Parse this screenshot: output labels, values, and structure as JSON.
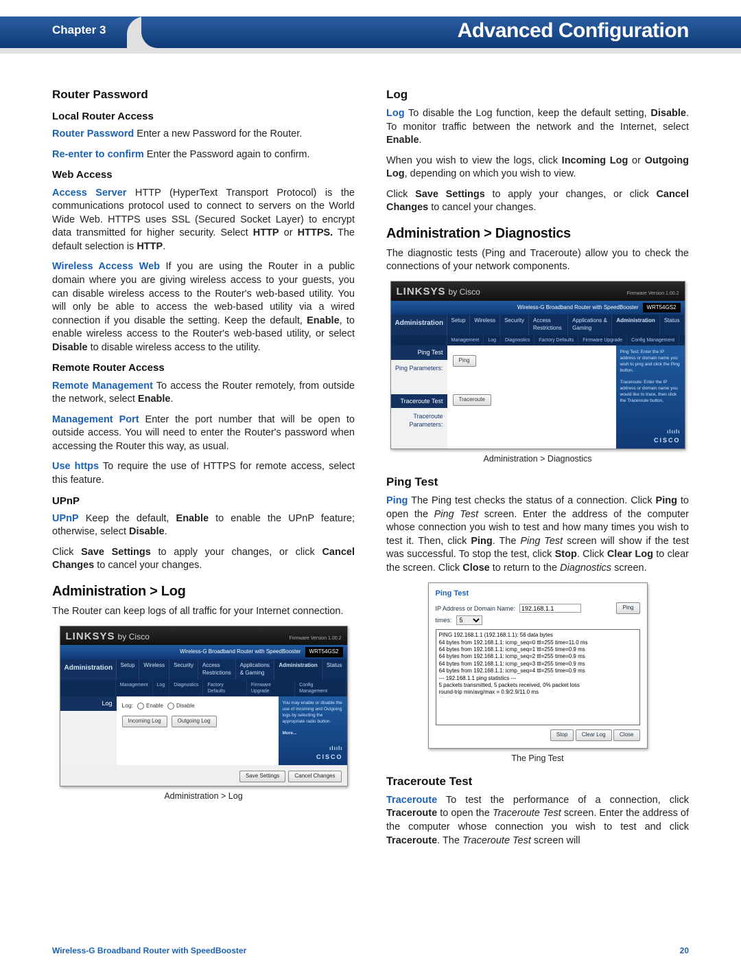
{
  "header": {
    "chapter": "Chapter 3",
    "title": "Advanced Configuration"
  },
  "left": {
    "h_router_password": "Router Password",
    "h_local": "Local Router Access",
    "p_rp": {
      "kw": "Router Password",
      "txt": "  Enter a new Password for the Router."
    },
    "p_re": {
      "kw": "Re-enter to confirm",
      "txt": "  Enter the Password again to confirm."
    },
    "h_web": "Web Access",
    "p_as": {
      "kw": "Access Server",
      "txt1": " HTTP (HyperText Transport Protocol) is the communications protocol used to connect to servers on the World Wide Web. HTTPS uses SSL (Secured Socket Layer) to encrypt data transmitted for higher security. Select ",
      "b1": "HTTP",
      "txt2": " or ",
      "b2": "HTTPS.",
      "txt3": "  The default selection is ",
      "b3": "HTTP",
      "txt4": "."
    },
    "p_waw": {
      "kw": "Wireless Access Web",
      "txt1": " If you are using the Router in a public domain where you are giving wireless access to your guests, you can disable wireless access to the Router's web-based utility. You will only be able to access the web-based utility via a wired connection if you disable the setting. Keep the default, ",
      "b1": "Enable",
      "txt2": ", to enable wireless access to the Router's web-based utility, or select ",
      "b2": "Disable",
      "txt3": " to disable wireless access to the utility."
    },
    "h_remote": "Remote Router Access",
    "p_rm": {
      "kw": "Remote Management",
      "txt1": " To access the Router remotely, from outside the network, select ",
      "b1": "Enable",
      "txt2": "."
    },
    "p_mp": {
      "kw": "Management Port",
      "txt": "  Enter the port number that will be open to outside access. You will need to enter the Router's password when accessing the Router this way, as usual."
    },
    "p_uh": {
      "kw": "Use https",
      "txt": "  To require the use of HTTPS for remote access, select this feature."
    },
    "h_upnp": "UPnP",
    "p_up": {
      "kw": "UPnP",
      "txt1": " Keep the default, ",
      "b1": "Enable",
      "txt2": " to enable the UPnP feature; otherwise, select ",
      "b2": "Disable",
      "txt3": "."
    },
    "p_save1": {
      "txt1": "Click ",
      "b1": "Save Settings",
      "txt2": " to apply your changes, or click ",
      "b2": "Cancel Changes",
      "txt3": " to cancel your changes."
    },
    "h_admin_log": "Administration > Log",
    "p_al": "The Router can keep logs of all traffic for your Internet connection.",
    "shot_log": {
      "brand": "LINKSYS",
      "brand_by": "by Cisco",
      "fw": "Firmware Version 1.00.2",
      "band": "Wireless-G Broadband Router with SpeedBooster",
      "model": "WRT54GS2",
      "section": "Administration",
      "tabs": [
        "Setup",
        "Wireless",
        "Security",
        "Access Restrictions",
        "Applications & Gaming",
        "Administration",
        "Status"
      ],
      "subtabs": [
        "Management",
        "Log",
        "Diagnostics",
        "Factory Defaults",
        "Firmware Upgrade",
        "Config Management"
      ],
      "left_dark": "Log",
      "row_label": "Log:",
      "r1": "Enable",
      "r2": "Disable",
      "btn_in": "Incoming Log",
      "btn_out": "Outgoing Log",
      "help": "You may enable or disable the use of Incoming and Outgoing logs by selecting the appropriate radio button.",
      "more": "More...",
      "cisco_bars": "ılıılı",
      "cisco": "CISCO",
      "save": "Save Settings",
      "cancel": "Cancel Changes"
    },
    "cap_log": "Administration > Log"
  },
  "right": {
    "h_log": "Log",
    "p_log": {
      "kw": "Log",
      "txt1": "  To disable the Log function, keep the default setting, ",
      "b1": "Disable",
      "txt2": ". To monitor traffic between the network and the Internet, select ",
      "b2": "Enable",
      "txt3": "."
    },
    "p_view": {
      "txt1": "When you wish to view the logs, click ",
      "b1": "Incoming Log",
      "txt2": " or ",
      "b2": "Outgoing Log",
      "txt3": ", depending on which you wish to view."
    },
    "p_save2": {
      "txt1": "Click ",
      "b1": "Save Settings",
      "txt2": " to apply your changes, or click ",
      "b2": "Cancel Changes",
      "txt3": " to cancel your changes."
    },
    "h_diag": "Administration > Diagnostics",
    "p_diag": "The diagnostic tests (Ping and Traceroute) allow you to check the connections of your network components.",
    "shot_diag": {
      "left1": "Ping Test",
      "left1b": "Ping Parameters:",
      "left2": "Traceroute Test",
      "left2b": "Traceroute Parameters:",
      "btn_ping": "Ping",
      "btn_tr": "Traceroute",
      "help1": "Ping Test: Enter the IP address or domain name you wish to ping and click the Ping button.",
      "help2": "Traceroute: Enter the IP address or domain name you would like to trace, then click the Traceroute button."
    },
    "cap_diag": "Administration > Diagnostics",
    "h_ping": "Ping Test",
    "p_ping": {
      "kw": "Ping",
      "txt1": "  The Ping test checks the status of a connection. Click ",
      "b1": "Ping",
      "txt2": " to open the ",
      "i1": "Ping Test",
      "txt3": " screen. Enter the address of the computer whose connection you wish to test and how many times you wish to test it. Then, click ",
      "b2": "Ping",
      "txt4": ". The ",
      "i2": "Ping Test",
      "txt5": " screen will show if the test was successful. To stop the test, click ",
      "b3": "Stop",
      "txt6": ". Click ",
      "b4": "Clear Log",
      "txt7": " to clear the screen. Click ",
      "b5": "Close",
      "txt8": " to return to the ",
      "i3": "Diagnostics",
      "txt9": " screen."
    },
    "shot_ping": {
      "title": "Ping Test",
      "lbl_ip": "IP Address or Domain Name:",
      "ip": "192.168.1.1",
      "lbl_times": "times:",
      "times": "5",
      "btn_ping": "Ping",
      "lines": [
        "PING 192.168.1.1 (192.168.1.1): 56 data bytes",
        "64 bytes from 192.168.1.1: icmp_seq=0 ttl=255 time=11.0 ms",
        "64 bytes from 192.168.1.1: icmp_seq=1 ttl=255 time=0.9 ms",
        "64 bytes from 192.168.1.1: icmp_seq=2 ttl=255 time=0.9 ms",
        "64 bytes from 192.168.1.1: icmp_seq=3 ttl=255 time=0.9 ms",
        "64 bytes from 192.168.1.1: icmp_seq=4 ttl=255 time=0.9 ms",
        "--- 192.168.1.1 ping statistics ---",
        "5 packets transmitted, 5 packets received, 0% packet loss",
        "round-trip min/avg/max = 0.9/2.9/11.0 ms"
      ],
      "btn_stop": "Stop",
      "btn_clear": "Clear Log",
      "btn_close": "Close"
    },
    "cap_ping": "The Ping Test",
    "h_tr": "Traceroute Test",
    "p_tr": {
      "kw": "Traceroute",
      "txt1": " To test the performance of a connection, click ",
      "b1": "Traceroute",
      "txt2": " to open the ",
      "i1": "Traceroute Test",
      "txt3": " screen. Enter the address of the computer whose connection you wish to test and click ",
      "b2": "Traceroute",
      "txt4": ". The ",
      "i2": "Traceroute Test",
      "txt5": " screen will"
    }
  },
  "footer": {
    "title": "Wireless-G Broadband Router with SpeedBooster",
    "page": "20"
  }
}
